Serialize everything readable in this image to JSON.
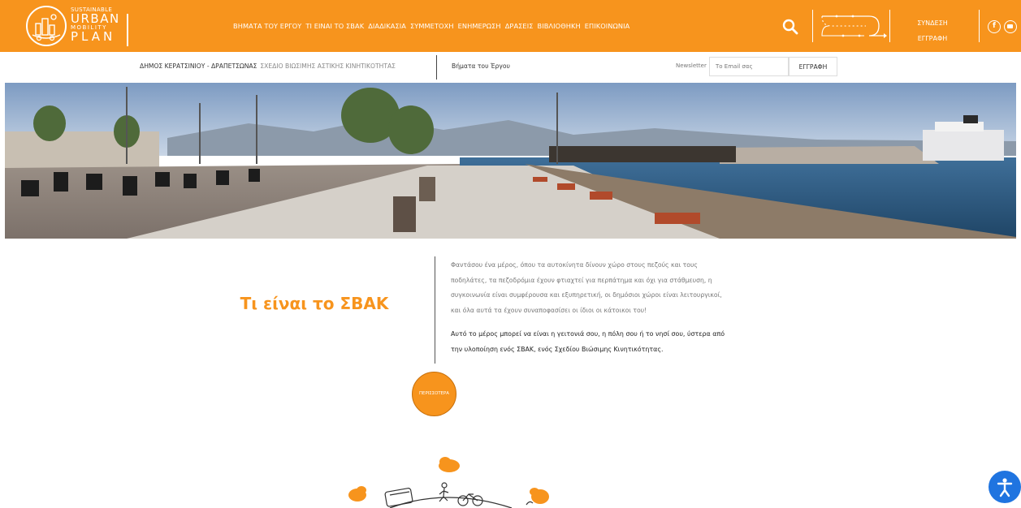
{
  "colors": {
    "brand_orange": "#f7941d",
    "accessibility_blue": "#1f74e0"
  },
  "header": {
    "logo": {
      "line1": "SUSTAINABLE",
      "line2": "URBAN",
      "line3": "MOBILITY",
      "line4": "PLAN"
    },
    "nav": [
      {
        "label": "ΒΗΜΑΤΑ ΤΟΥ ΕΡΓΟΥ"
      },
      {
        "label": "ΤΙ ΕΙΝΑΙ ΤΟ ΣΒΑΚ"
      },
      {
        "label": "ΔΙΑΔΙΚΑΣΙΑ"
      },
      {
        "label": "ΣΥΜΜΕΤΟΧΗ"
      },
      {
        "label": "ΕΝΗΜΕΡΩΣΗ"
      },
      {
        "label": "ΔΡΑΣΕΙΣ"
      },
      {
        "label": "ΒΙΒΛΙΟΘΗΚΗ"
      },
      {
        "label": "ΕΠΙΚΟΙΝΩΝΙΑ"
      }
    ],
    "search_icon": "search-icon",
    "auth": {
      "login": "ΣΥΝΔΕΣΗ",
      "register": "ΕΓΓΡΑΦΗ"
    },
    "social_icons": [
      "facebook-icon",
      "youtube-icon"
    ]
  },
  "subheader": {
    "municipality": "ΔΗΜΟΣ ΚΕΡΑΤΣΙΝΙΟΥ - ΔΡΑΠΕΤΣΩΝΑΣ",
    "plan_name": "ΣΧΕΔΙΟ ΒΙΩΣΙΜΗΣ ΑΣΤΙΚΗΣ ΚΙΝΗΤΙΚΟΤΗΤΑΣ",
    "steps_link": "Βήματα του Έργου",
    "newsletter": {
      "label": "Newsletter",
      "placeholder": "Το Email σας",
      "button": "ΕΓΓΡΑΦΗ"
    }
  },
  "intro": {
    "title": "Τι είναι το ΣΒΑΚ",
    "paragraph1": "Φαντάσου ένα μέρος, όπου τα αυτοκίνητα δίνουν χώρο στους πεζούς και τους ποδηλάτες, τα πεζοδρόμια έχουν φτιαχτεί για περπάτημα και όχι για στάθμευση, η συγκοινωνία είναι συμφέρουσα και εξυπηρετική, οι δημόσιοι χώροι είναι λειτουργικοί, και όλα αυτά τα έχουν συναποφασίσει οι ίδιοι οι κάτοικοι του!",
    "paragraph2": "Αυτό το μέρος μπορεί να είναι η γειτονιά σου, η πόλη σου ή το νησί σου, ύστερα από την υλοποίηση ενός ΣΒΑΚ, ενός Σχεδίου Βιώσιμης Κινητικότητας.",
    "more_button": "ΠΕΡΙΣΣΟΤΕΡΑ"
  },
  "widgets": {
    "accessibility_icon": "accessibility-icon"
  }
}
